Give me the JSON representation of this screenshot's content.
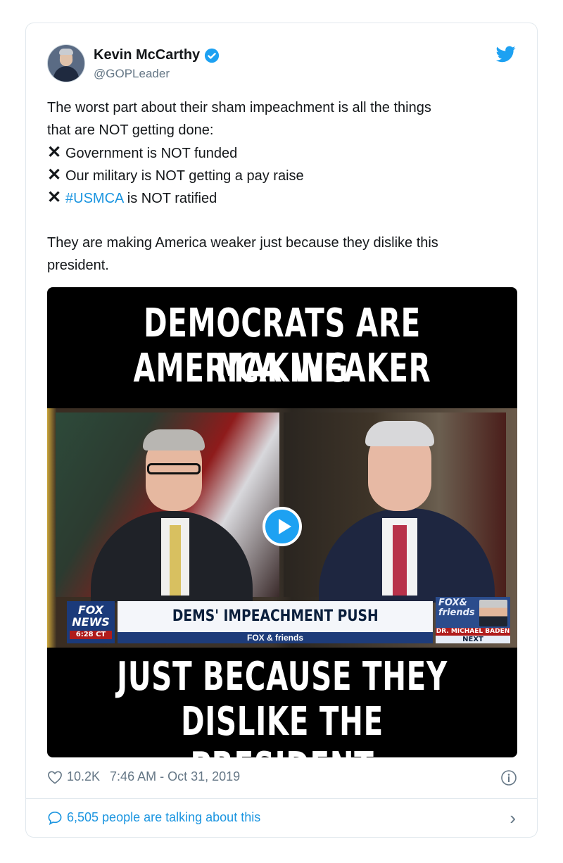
{
  "user": {
    "name": "Kevin McCarthy",
    "handle": "@GOPLeader"
  },
  "tweet": {
    "line1": "The worst part about their sham impeachment is all the things",
    "line2": "that are NOT getting done:",
    "bullets": [
      {
        "mark": "✕",
        "text": "Government is NOT funded"
      },
      {
        "mark": "✕",
        "text": "Our military is NOT getting a pay raise"
      },
      {
        "mark": "✕",
        "hashtag": "#USMCA",
        "text": " is NOT ratified"
      }
    ],
    "closing_line1": "They are making America weaker just because they dislike this",
    "closing_line2": "president."
  },
  "media": {
    "headline_top_1": "DEMOCRATS ARE MAKING",
    "headline_top_2": "AMERICA WEAKER",
    "headline_bottom_1": "JUST BECAUSE THEY",
    "headline_bottom_2": "DISLIKE THE PRESIDENT",
    "fox_logo_1": "FOX",
    "fox_logo_2": "NEWS",
    "fox_time": "6:28 CT",
    "banner": "DEMS' IMPEACHMENT PUSH",
    "sub_banner": "FOX & friends",
    "promo_brand": "FOX& friends",
    "promo_guest": "DR. MICHAEL BADEN",
    "promo_next": "NEXT"
  },
  "stats": {
    "likes": "10.2K",
    "timestamp": "7:46 AM - Oct 31, 2019"
  },
  "footer": {
    "talking": "6,505 people are talking about this"
  },
  "colors": {
    "link": "#1b95e0",
    "muted": "#657786",
    "verified": "#1da1f2"
  }
}
